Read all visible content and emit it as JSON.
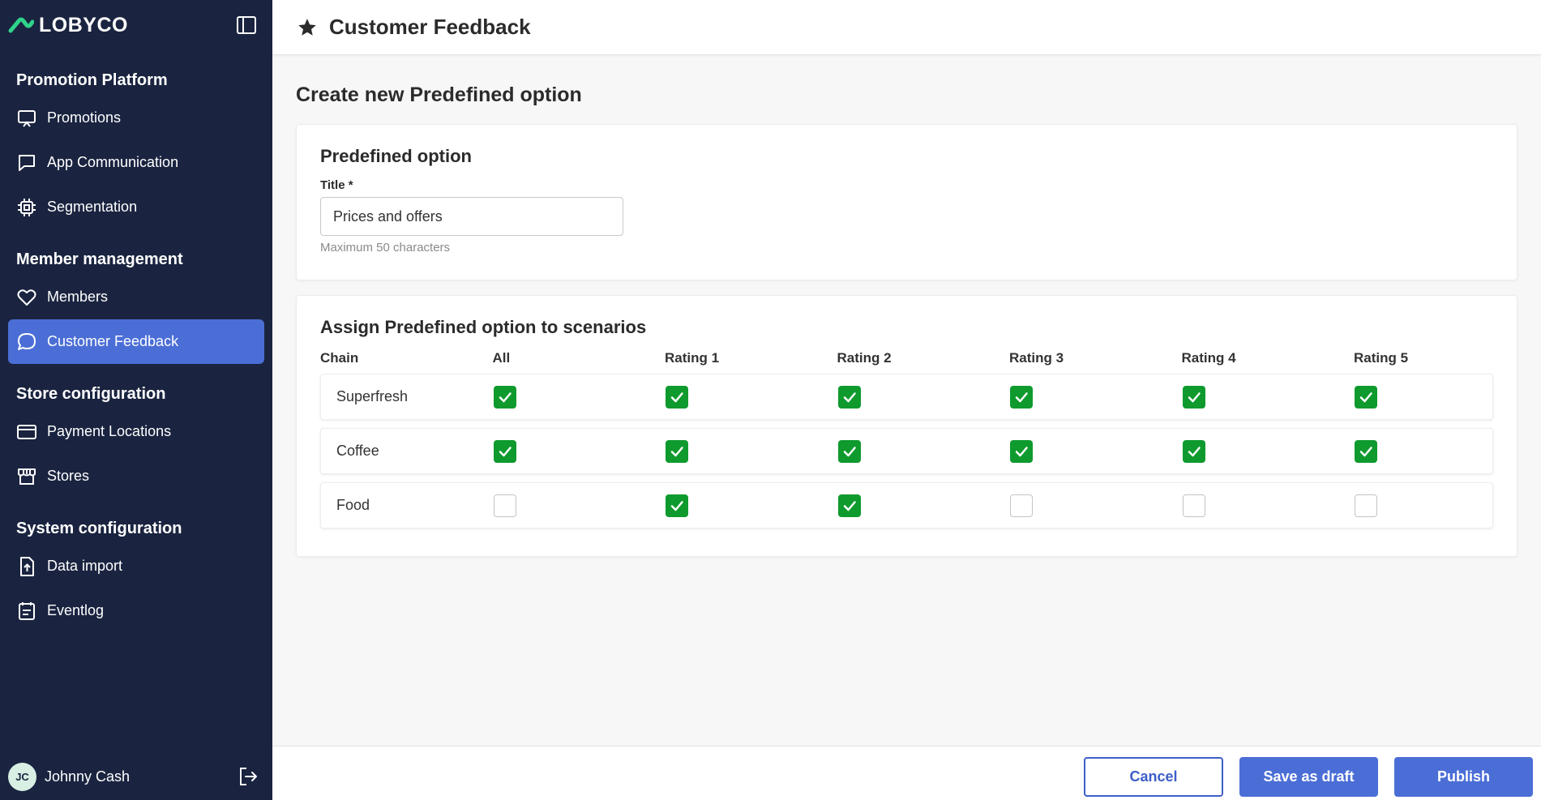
{
  "app": {
    "logo_text": "LOBYCO"
  },
  "sidebar": {
    "sections": [
      {
        "title": "Promotion Platform",
        "items": [
          {
            "label": "Promotions",
            "icon": "presentation-icon"
          },
          {
            "label": "App Communication",
            "icon": "chat-bubble-icon"
          },
          {
            "label": "Segmentation",
            "icon": "chip-icon"
          }
        ]
      },
      {
        "title": "Member management",
        "items": [
          {
            "label": "Members",
            "icon": "heart-icon"
          },
          {
            "label": "Customer Feedback",
            "icon": "speech-bubble-icon",
            "active": true
          }
        ]
      },
      {
        "title": "Store configuration",
        "items": [
          {
            "label": "Payment Locations",
            "icon": "credit-card-icon"
          },
          {
            "label": "Stores",
            "icon": "storefront-icon"
          }
        ]
      },
      {
        "title": "System configuration",
        "items": [
          {
            "label": "Data import",
            "icon": "file-upload-icon"
          },
          {
            "label": "Eventlog",
            "icon": "calendar-list-icon"
          }
        ]
      }
    ],
    "user": {
      "initials": "JC",
      "name": "Johnny Cash"
    }
  },
  "header": {
    "title": "Customer Feedback",
    "icon": "star-icon"
  },
  "main": {
    "page_title": "Create new Predefined option",
    "option_card": {
      "title": "Predefined option",
      "field_label": "Title *",
      "field_value": "Prices and offers",
      "helper": "Maximum 50 characters"
    },
    "scenario_card": {
      "title": "Assign Predefined option to scenarios",
      "columns": [
        "Chain",
        "All",
        "Rating 1",
        "Rating 2",
        "Rating 3",
        "Rating 4",
        "Rating 5"
      ],
      "rows": [
        {
          "chain": "Superfresh",
          "checks": [
            true,
            true,
            true,
            true,
            true,
            true
          ]
        },
        {
          "chain": "Coffee",
          "checks": [
            true,
            true,
            true,
            true,
            true,
            true
          ]
        },
        {
          "chain": "Food",
          "checks": [
            false,
            true,
            true,
            false,
            false,
            false
          ]
        }
      ]
    }
  },
  "footer": {
    "cancel_label": "Cancel",
    "draft_label": "Save as draft",
    "publish_label": "Publish"
  },
  "colors": {
    "sidebar_bg": "#1a2440",
    "accent": "#4b6ed6",
    "check_on": "#0f9a2e"
  }
}
